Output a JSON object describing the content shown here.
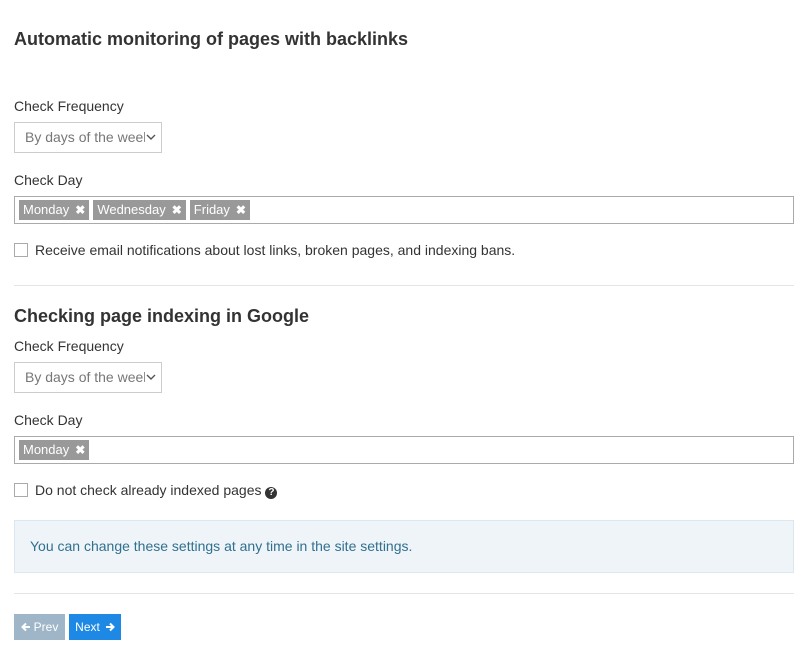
{
  "section1": {
    "title": "Automatic monitoring of pages with backlinks",
    "frequency_label": "Check Frequency",
    "frequency_value": "By days of the week",
    "day_label": "Check Day",
    "days": [
      "Monday",
      "Wednesday",
      "Friday"
    ],
    "email_checkbox_label": "Receive email notifications about lost links, broken pages, and indexing bans.",
    "email_checked": false
  },
  "section2": {
    "title": "Checking page indexing in Google",
    "frequency_label": "Check Frequency",
    "frequency_value": "By days of the week",
    "day_label": "Check Day",
    "days": [
      "Monday"
    ],
    "indexed_checkbox_label": "Do not check already indexed pages",
    "indexed_checked": false
  },
  "info_message": "You can change these settings at any time in the site settings.",
  "nav": {
    "prev_label": "Prev",
    "next_label": "Next"
  },
  "icons": {
    "remove_tag": "times-icon",
    "help": "question-circle-icon",
    "prev": "arrow-left-icon",
    "next": "arrow-right-icon",
    "select": "chevron-down-icon"
  },
  "colors": {
    "tag_bg": "#999999",
    "primary_button": "#1e88e5",
    "disabled_button": "#9fb6c8",
    "info_text": "#31708f",
    "info_bg": "#eef4f7"
  }
}
